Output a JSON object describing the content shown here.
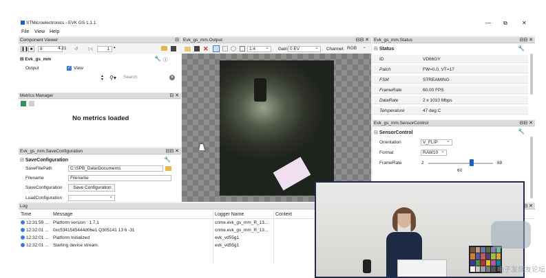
{
  "window": {
    "title": "STMicroelectronics - EVK GS 1.1.1",
    "controls": [
      "—",
      "⧉",
      "✕"
    ]
  },
  "menu": [
    "File",
    "View",
    "Help"
  ],
  "component_viewer": {
    "title": "Component Viewer",
    "frame_value": "8",
    "rate_value": "4.21",
    "step_value": "1",
    "node_label": "Evk_gs_mm",
    "output_label": "Output",
    "view_label": "View",
    "search_placeholder": "Search"
  },
  "metrics": {
    "title": "Metrics Manager",
    "empty_message": "No metrics loaded"
  },
  "save_config": {
    "title": "Evk_gs_mm.SaveConfiguration",
    "section": "SaveConfiguration",
    "rows": [
      {
        "label": "SaveFilePath",
        "value": "C:\\SPB_Data\\Documents"
      },
      {
        "label": "Filename",
        "value": "Filename"
      },
      {
        "label": "SaveConfiguration",
        "value": "Save Configuration"
      },
      {
        "label": "LoadConfiguration",
        "value": ""
      }
    ]
  },
  "output": {
    "title": "Evk_gs_mm.Output",
    "zoom": "1:4",
    "gain_label": "Gain:",
    "gain_value": "0 EV",
    "channel_label": "Channel:",
    "channel_value": "RGB"
  },
  "status": {
    "title": "Evk_gs_mm.Status",
    "section": "Status",
    "rows": [
      {
        "label": "ID",
        "value": "VD66GY"
      },
      {
        "label": "Patch",
        "value": "FW=0.0, VT=17"
      },
      {
        "label": "FSM",
        "value": "STREAMING"
      },
      {
        "label": "FrameRate",
        "value": "60.00 FPS"
      },
      {
        "label": "DataRate",
        "value": "2 x 1010 Mbps"
      },
      {
        "label": "Temperature",
        "value": "47 deg C"
      }
    ]
  },
  "sensor_control": {
    "title": "Evk_gs_mm.SensorControl",
    "section": "SensorControl",
    "orientation_label": "Orientation",
    "orientation_value": "V_FLIP",
    "format_label": "Format",
    "format_value": "RAW10",
    "framerate_label": "FrameRate",
    "framerate_min": "2",
    "framerate_max": "88",
    "framerate_value": "60",
    "framerate_fraction": 0.674
  },
  "log": {
    "title": "Log",
    "headers": [
      "Time",
      "Message",
      "Logger Name",
      "Context"
    ],
    "rows": [
      {
        "time": "12:31:59 ...",
        "message": "Platform version : 1.7.1",
        "logger": "crime.evk_gs_mm_R_13..."
      },
      {
        "time": "12:32:01 ...",
        "message": "0xc5341545444d06e1 Q305141 13 6 -31",
        "logger": "crime.evk_gs_mm_R_13..."
      },
      {
        "time": "12:32:01 ...",
        "message": "Platform Initialized",
        "logger": "evk_vd55g1"
      },
      {
        "time": "12:32:01 ...",
        "message": "Starting device stream.",
        "logger": "evk_vd55g1"
      }
    ]
  },
  "watermark": "电子发烧友论坛",
  "colors": {
    "accent": "#3a7bd5",
    "video_border": "#1c2b4a",
    "slider_handle": "#1f5fc4"
  }
}
